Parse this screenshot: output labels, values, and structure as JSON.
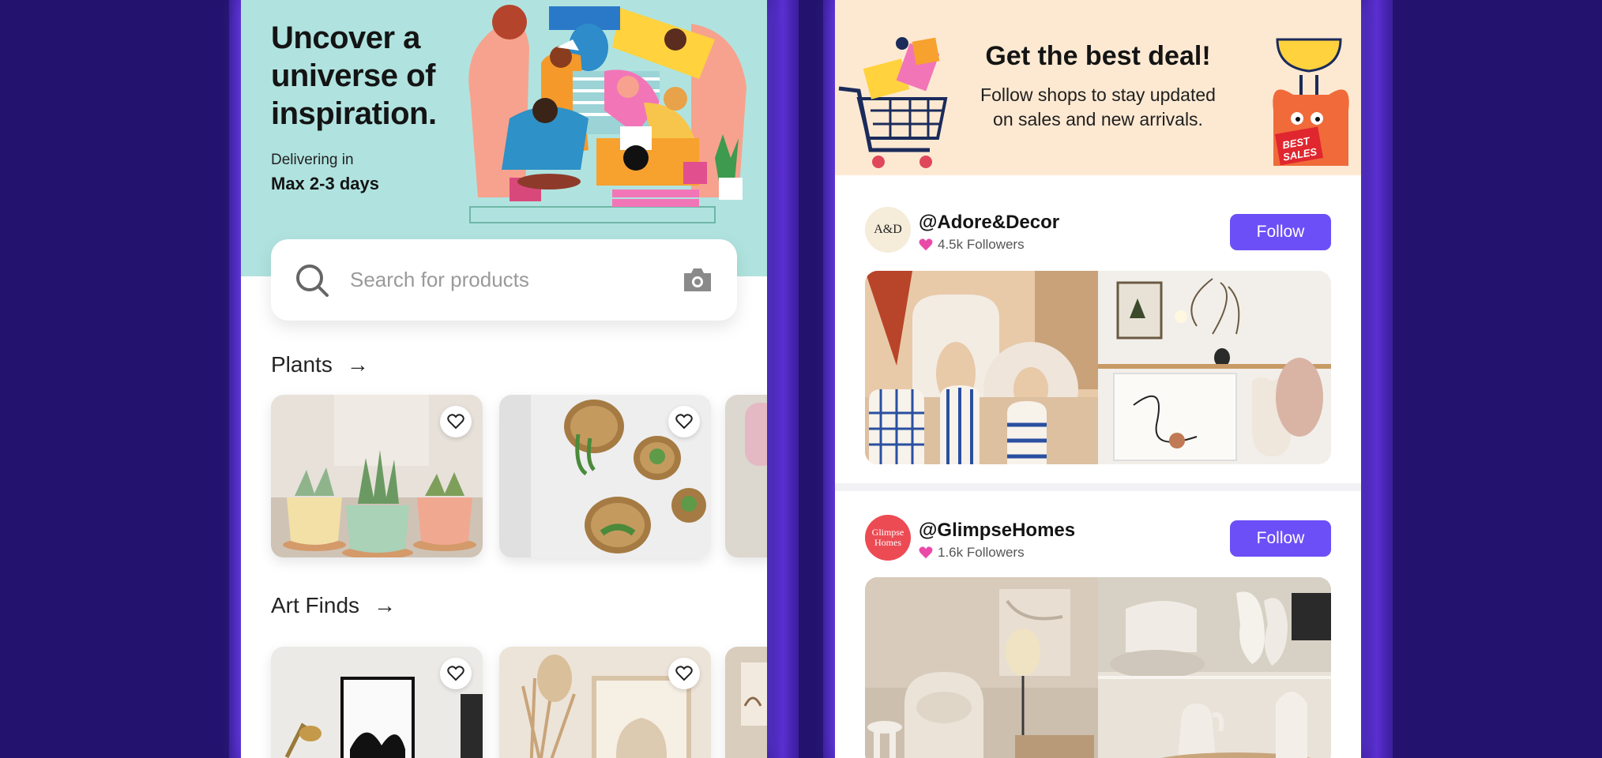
{
  "left_screen": {
    "hero": {
      "title": "Uncover a universe of inspiration.",
      "delivery_label": "Delivering in",
      "delivery_value": "Max 2-3 days"
    },
    "search": {
      "placeholder": "Search for products"
    },
    "sections": [
      {
        "title": "Plants",
        "arrow": "→"
      },
      {
        "title": "Art Finds",
        "arrow": "→"
      }
    ]
  },
  "right_screen": {
    "banner": {
      "title": "Get the best deal!",
      "subtitle": "Follow shops to stay updated on sales and new arrivals."
    },
    "shops": [
      {
        "avatar": "A&D",
        "handle": "@Adore&Decor",
        "followers": "4.5k Followers",
        "button": "Follow"
      },
      {
        "avatar": "Glimpse Homes",
        "handle": "@GlimpseHomes",
        "followers": "1.6k Followers",
        "button": "Follow"
      }
    ]
  },
  "colors": {
    "background": "#24136e",
    "hero": "#b0e3df",
    "banner": "#fde9d2",
    "follow": "#6c4ff6",
    "heart": "#e94aa8"
  },
  "icons": [
    "search-icon",
    "camera-icon",
    "arrow-right-icon",
    "heart-icon"
  ]
}
